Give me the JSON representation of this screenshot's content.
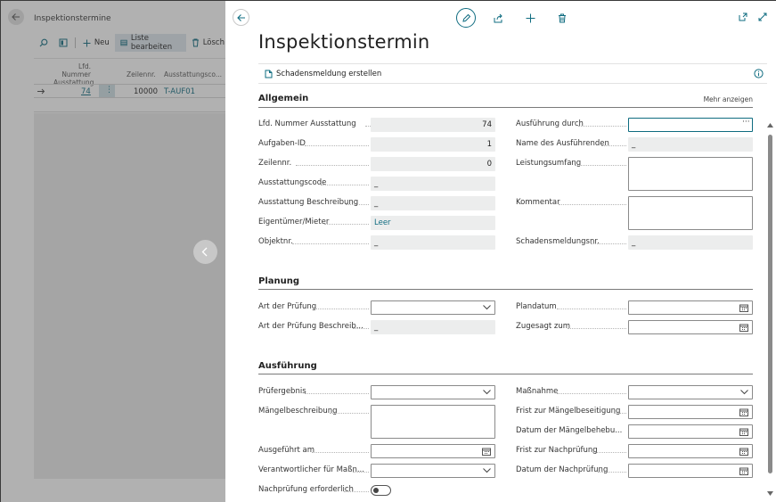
{
  "background": {
    "title": "Inspektionstermine",
    "toolbar": {
      "new_label": "Neu",
      "edit_list_label": "Liste bearbeiten",
      "delete_label": "Lösch"
    },
    "columns": {
      "lfd_nummer": "Lfd. Nummer",
      "ausstattung": "Ausstattung",
      "zeilennr": "Zeilennr.",
      "ausstattungscode": "Ausstattungsco..."
    },
    "row": {
      "lfd_nummer": "74",
      "zeilennr": "10000",
      "code": "T-AUF01"
    }
  },
  "panel": {
    "title": "Inspektionstermin",
    "command": "Schadensmeldung erstellen",
    "sections": {
      "allgemein": {
        "title": "Allgemein",
        "more_label": "Mehr anzeigen",
        "left": [
          {
            "label": "Lfd. Nummer Ausstattung",
            "value": "74"
          },
          {
            "label": "Aufgaben-ID",
            "value": "1"
          },
          {
            "label": "Zeilennr.",
            "value": "0"
          },
          {
            "label": "Ausstattungscode",
            "value": "_"
          },
          {
            "label": "Ausstattung Beschreibung",
            "value": "_"
          },
          {
            "label": "Eigentümer/Mieter",
            "value": "Leer"
          },
          {
            "label": "Objektnr.",
            "value": "_"
          }
        ],
        "right": [
          {
            "label": "Ausführung durch",
            "value": ""
          },
          {
            "label": "Name des Ausführenden",
            "value": "_"
          },
          {
            "label": "Leistungsumfang",
            "value": ""
          },
          {
            "label": "Kommentar",
            "value": ""
          },
          {
            "label": "Schadensmeldungsnr.",
            "value": "_"
          }
        ]
      },
      "planung": {
        "title": "Planung",
        "left": [
          {
            "label": "Art der Prüfung",
            "value": ""
          },
          {
            "label": "Art der Prüfung Beschreib...",
            "value": "_"
          }
        ],
        "right": [
          {
            "label": "Plandatum",
            "value": ""
          },
          {
            "label": "Zugesagt zum",
            "value": ""
          }
        ]
      },
      "ausfuehrung": {
        "title": "Ausführung",
        "left": [
          {
            "label": "Prüfergebnis",
            "value": ""
          },
          {
            "label": "Mängelbeschreibung",
            "value": ""
          },
          {
            "label": "Ausgeführt am",
            "value": ""
          },
          {
            "label": "Verantwortlicher für Maßn...",
            "value": ""
          },
          {
            "label": "Nachprüfung erforderlich",
            "value": ""
          }
        ],
        "right": [
          {
            "label": "Maßnahme",
            "value": ""
          },
          {
            "label": "Frist zur Mängelbeseitigung",
            "value": ""
          },
          {
            "label": "Datum der Mängelbehebu...",
            "value": ""
          },
          {
            "label": "Frist zur Nachprüfung",
            "value": ""
          },
          {
            "label": "Datum der Nachprüfung",
            "value": ""
          }
        ]
      }
    }
  },
  "colors": {
    "accent": "#0f6c80",
    "readonly_bg": "#eceded"
  }
}
